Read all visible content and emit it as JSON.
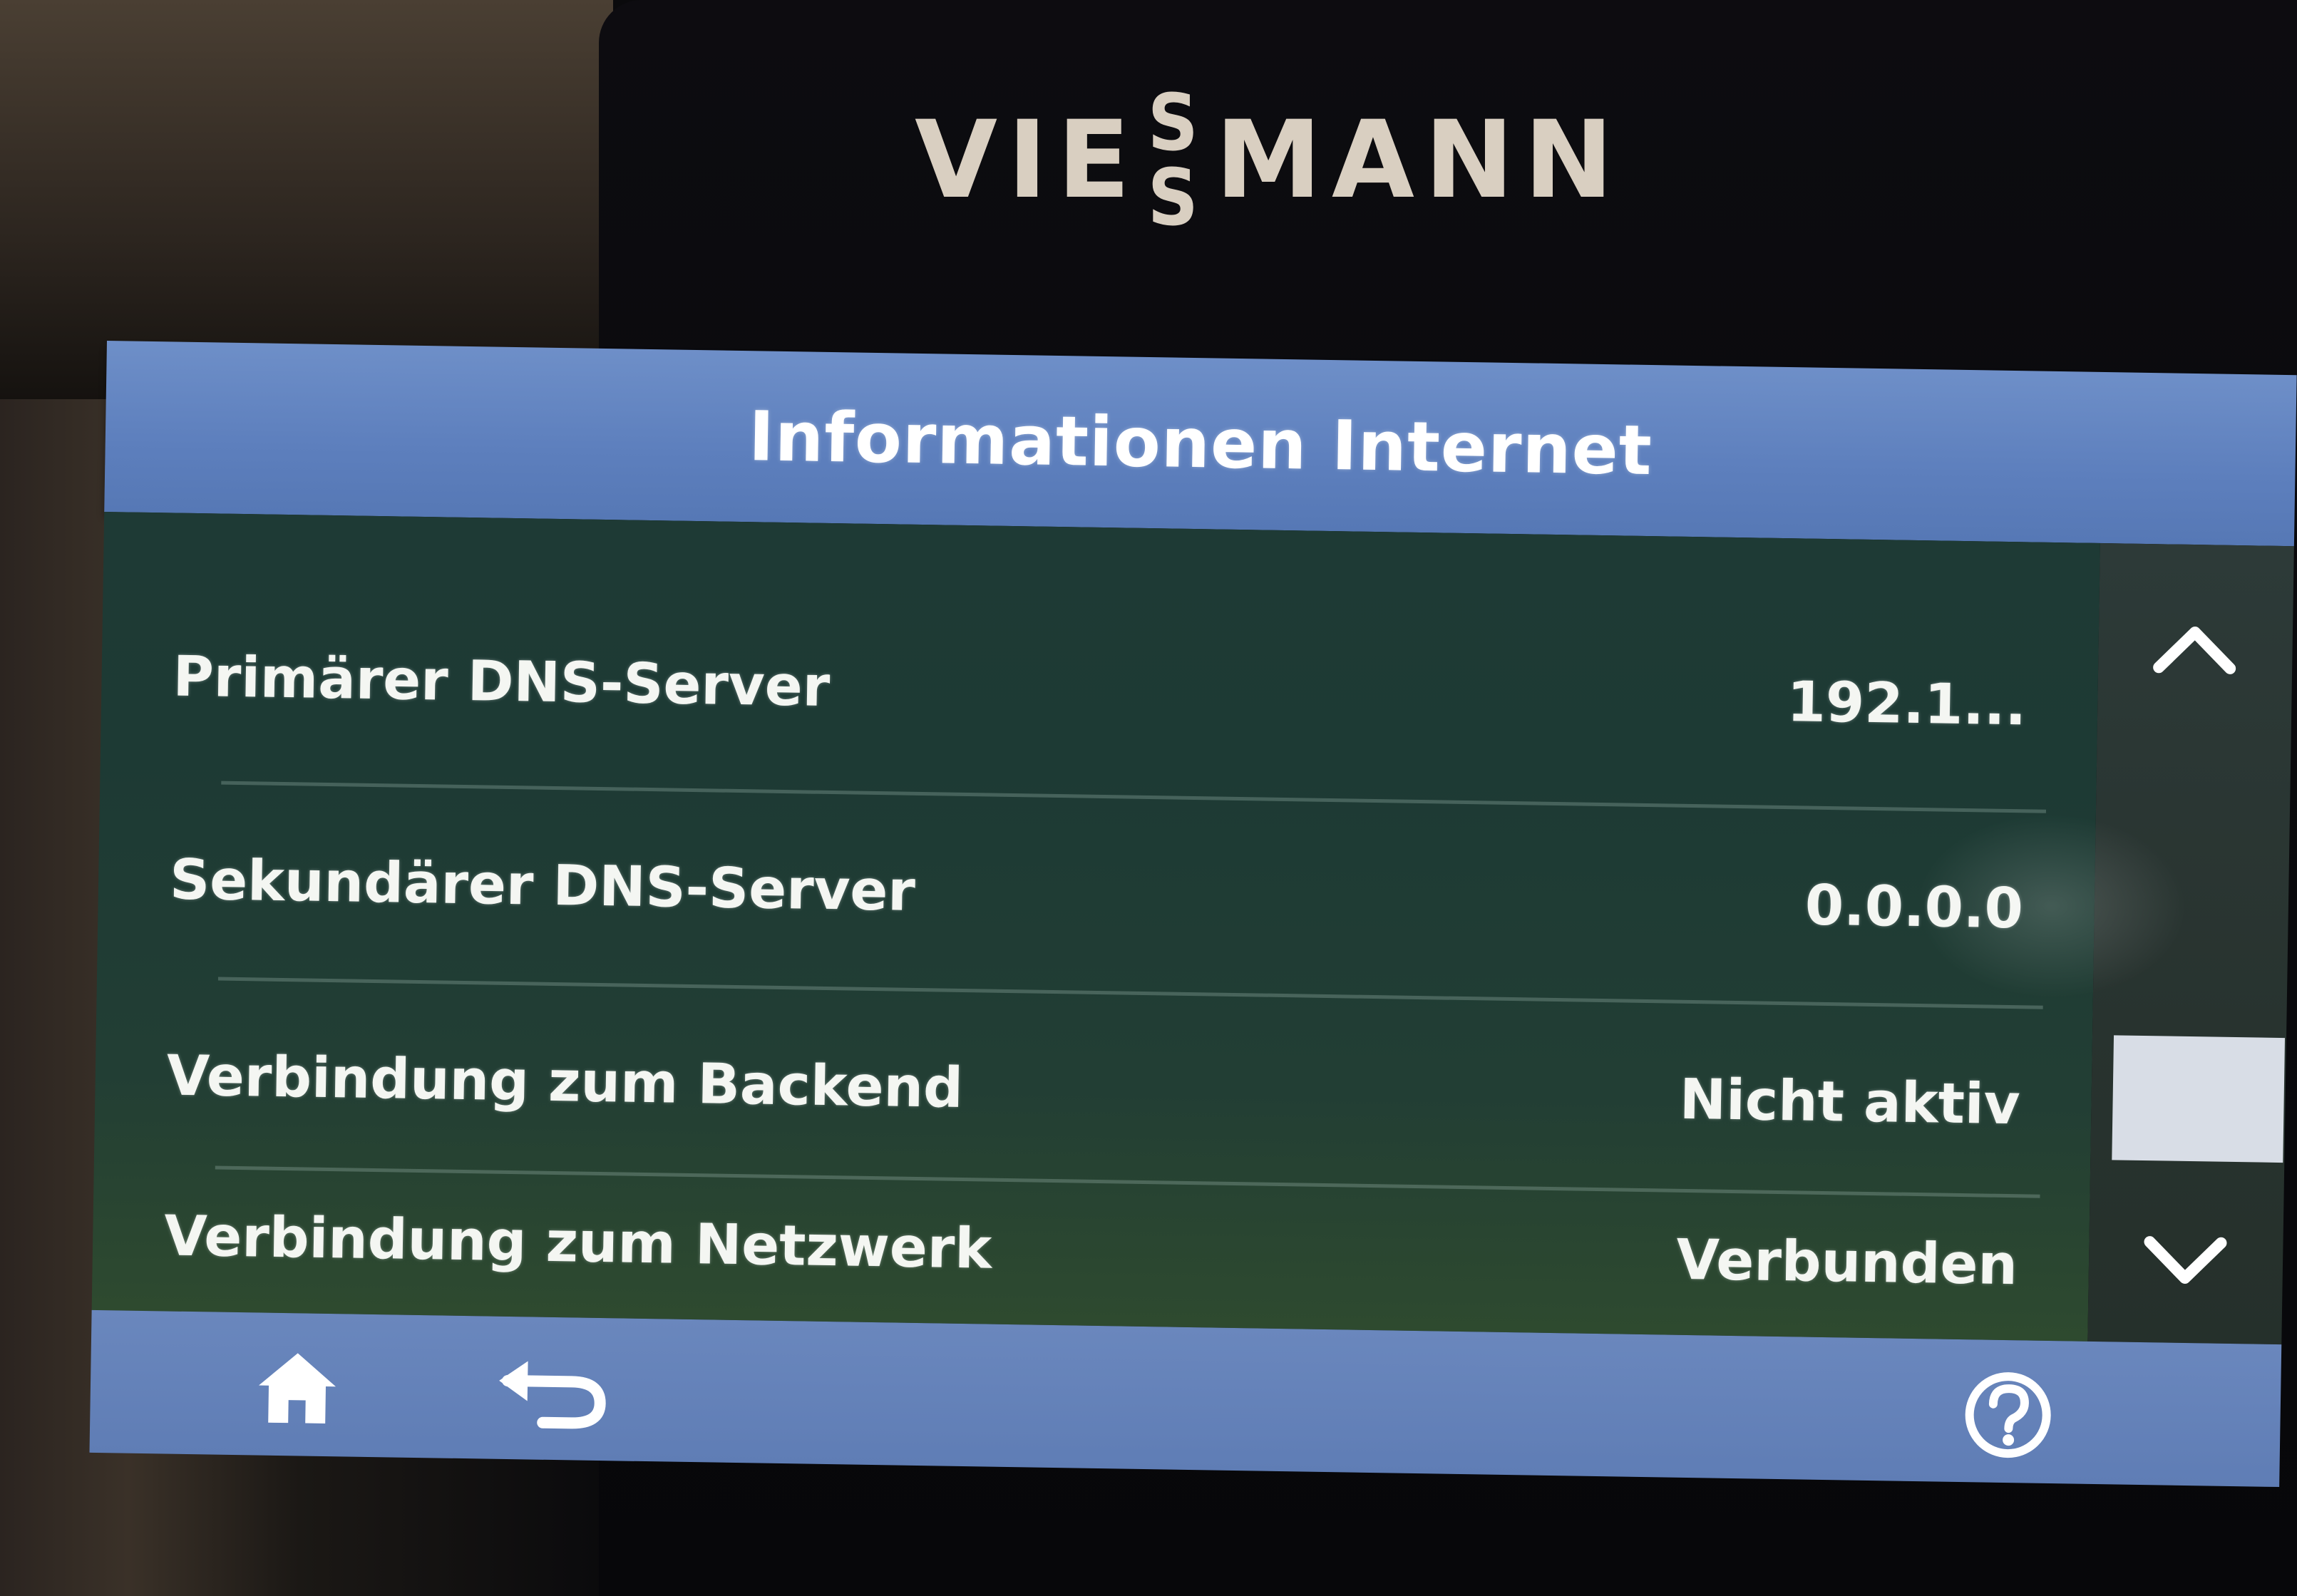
{
  "brand": {
    "logo_text": "VIESSMANN"
  },
  "screen": {
    "title": "Informationen Internet",
    "rows": [
      {
        "label": "Primärer DNS-Server",
        "value": "192.1..."
      },
      {
        "label": "Sekundärer DNS-Server",
        "value": "0.0.0.0"
      },
      {
        "label": "Verbindung zum Backend",
        "value": "Nicht aktiv"
      },
      {
        "label": "Verbindung zum Netzwerk",
        "value": "Verbunden"
      }
    ]
  },
  "scrollbar": {
    "up_icon": "chevron-up-icon",
    "down_icon": "chevron-down-icon"
  },
  "footer": {
    "home_icon": "home-icon",
    "back_icon": "back-arrow-icon",
    "help_icon": "help-icon"
  },
  "colors": {
    "titlebar": "#5d7fbd",
    "content": "#1e3a35",
    "text": "#f4f6f2",
    "scroll_thumb": "#d8dde6"
  }
}
